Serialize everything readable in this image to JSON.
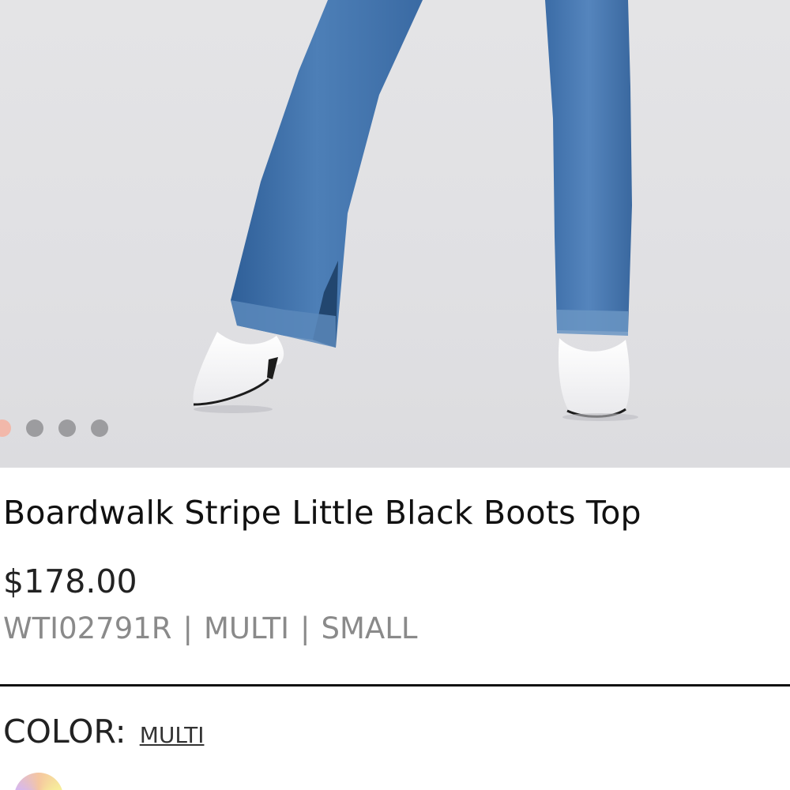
{
  "product": {
    "title": "Boardwalk Stripe Little Black Boots Top",
    "price": "$178.00",
    "sku": "WTI02791R",
    "color_code": "MULTI",
    "size": "SMALL",
    "separator": "|"
  },
  "color": {
    "label": "COLOR:",
    "value": "MULTI"
  },
  "gallery": {
    "dot_count": 4,
    "active_index": 0,
    "active_color": "#f2b8aa",
    "inactive_color": "#9c9c9f"
  }
}
